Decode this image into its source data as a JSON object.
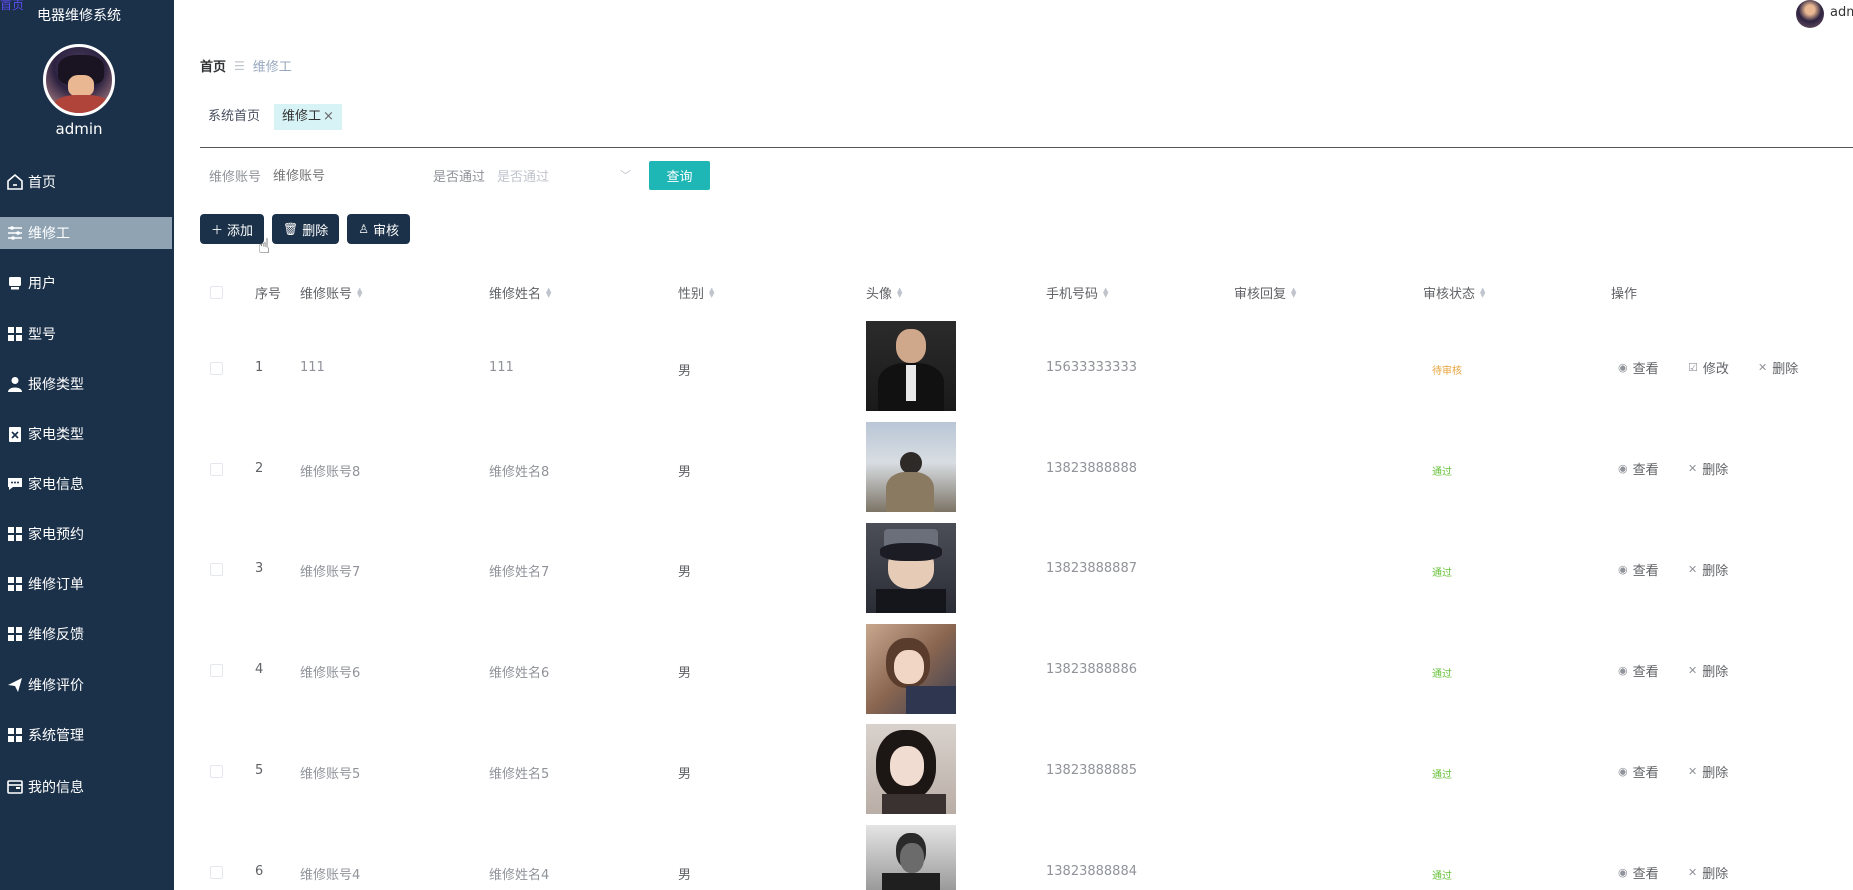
{
  "corner_tag": "首页",
  "app_title": "电器维修系统",
  "admin_name": "admin",
  "top_user": "adm",
  "nav": [
    {
      "label": "首页",
      "icon": "home-icon",
      "active": false
    },
    {
      "label": "维修工",
      "icon": "sliders-icon",
      "active": true
    },
    {
      "label": "用户",
      "icon": "user-card-icon",
      "active": false
    },
    {
      "label": "型号",
      "icon": "grid-icon",
      "active": false
    },
    {
      "label": "报修类型",
      "icon": "person-icon",
      "active": false
    },
    {
      "label": "家电类型",
      "icon": "clipboard-icon",
      "active": false
    },
    {
      "label": "家电信息",
      "icon": "chat-icon",
      "active": false
    },
    {
      "label": "家电预约",
      "icon": "grid-icon",
      "active": false
    },
    {
      "label": "维修订单",
      "icon": "grid-icon",
      "active": false
    },
    {
      "label": "维修反馈",
      "icon": "grid-icon",
      "active": false
    },
    {
      "label": "维修评价",
      "icon": "send-icon",
      "active": false
    },
    {
      "label": "系统管理",
      "icon": "grid-icon",
      "active": false
    },
    {
      "label": "我的信息",
      "icon": "wallet-icon",
      "active": false
    }
  ],
  "breadcrumb": {
    "home": "首页",
    "current": "维修工"
  },
  "tags": {
    "home": "系统首页",
    "current": "维修工",
    "close": "×"
  },
  "search": {
    "account_label": "维修账号",
    "account_placeholder": "维修账号",
    "pass_label": "是否通过",
    "pass_placeholder": "是否通过",
    "query_button": "查询"
  },
  "actions": {
    "add": "添加",
    "delete": "删除",
    "audit": "审核"
  },
  "table": {
    "headers": [
      "序号",
      "维修账号",
      "维修姓名",
      "性别",
      "头像",
      "手机号码",
      "审核回复",
      "审核状态",
      "操作"
    ],
    "rows": [
      {
        "idx": "1",
        "account": "111",
        "name": "111",
        "gender": "男",
        "phone": "15633333333",
        "reply": "",
        "status": "待审核",
        "status_type": "pending",
        "ops": [
          "查看",
          "修改",
          "删除"
        ]
      },
      {
        "idx": "2",
        "account": "维修账号8",
        "name": "维修姓名8",
        "gender": "男",
        "phone": "13823888888",
        "reply": "",
        "status": "通过",
        "status_type": "pass",
        "ops": [
          "查看",
          "删除"
        ]
      },
      {
        "idx": "3",
        "account": "维修账号7",
        "name": "维修姓名7",
        "gender": "男",
        "phone": "13823888887",
        "reply": "",
        "status": "通过",
        "status_type": "pass",
        "ops": [
          "查看",
          "删除"
        ]
      },
      {
        "idx": "4",
        "account": "维修账号6",
        "name": "维修姓名6",
        "gender": "男",
        "phone": "13823888886",
        "reply": "",
        "status": "通过",
        "status_type": "pass",
        "ops": [
          "查看",
          "删除"
        ]
      },
      {
        "idx": "5",
        "account": "维修账号5",
        "name": "维修姓名5",
        "gender": "男",
        "phone": "13823888885",
        "reply": "",
        "status": "通过",
        "status_type": "pass",
        "ops": [
          "查看",
          "删除"
        ]
      },
      {
        "idx": "6",
        "account": "维修账号4",
        "name": "维修姓名4",
        "gender": "男",
        "phone": "13823888884",
        "reply": "",
        "status": "通过",
        "status_type": "pass",
        "ops": [
          "查看",
          "删除"
        ]
      }
    ]
  },
  "colors": {
    "sidebar": "#1b3149",
    "accent": "#1fb6b6",
    "pending": "#e6a23c",
    "pass": "#67c23a"
  }
}
